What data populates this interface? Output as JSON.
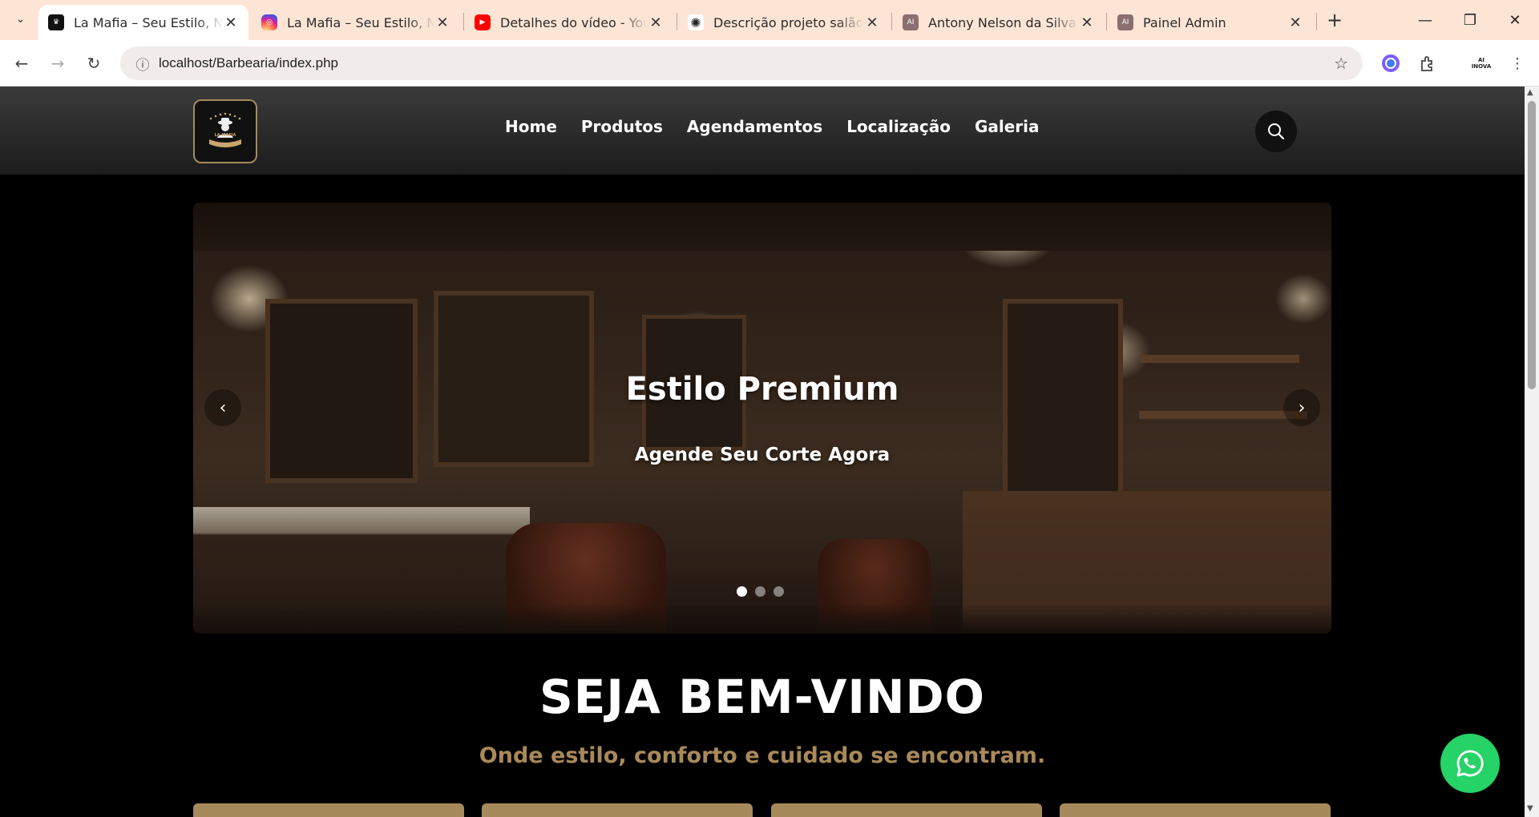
{
  "browser": {
    "tabs": [
      {
        "title": "La Mafia – Seu Estilo, Nosso",
        "favicon": "barbershop-logo-icon",
        "active": true
      },
      {
        "title": "La Mafia – Seu Estilo, Nosso",
        "favicon": "instagram-icon",
        "active": false
      },
      {
        "title": "Detalhes do vídeo - YouTube",
        "favicon": "youtube-icon",
        "active": false
      },
      {
        "title": "Descrição projeto salão bel",
        "favicon": "chatgpt-icon",
        "active": false
      },
      {
        "title": "Antony Nelson da Silva | D",
        "favicon": "ai-inova-icon",
        "active": false
      },
      {
        "title": "Painel Admin",
        "favicon": "ai-inova-icon",
        "active": false
      }
    ],
    "url": "localhost/Barbearia/index.php",
    "profile_label": "AI INOVA"
  },
  "site": {
    "logo_text": "LA MAFIA",
    "nav": [
      "Home",
      "Produtos",
      "Agendamentos",
      "Localização",
      "Galeria"
    ],
    "hero": {
      "title": "Estilo Premium",
      "subtitle": "Agende Seu Corte Agora",
      "prev": "‹",
      "next": "›",
      "slide_count": 3,
      "active_slide": 1
    },
    "welcome_title": "SEJA BEM-VINDO",
    "welcome_tagline": "Onde estilo, conforto e cuidado se encontram."
  },
  "colors": {
    "accent_gold": "#a9895a",
    "card_gold": "#a68a5b",
    "whatsapp_green": "#25d366",
    "tabbar_bg": "#fde5d6"
  }
}
